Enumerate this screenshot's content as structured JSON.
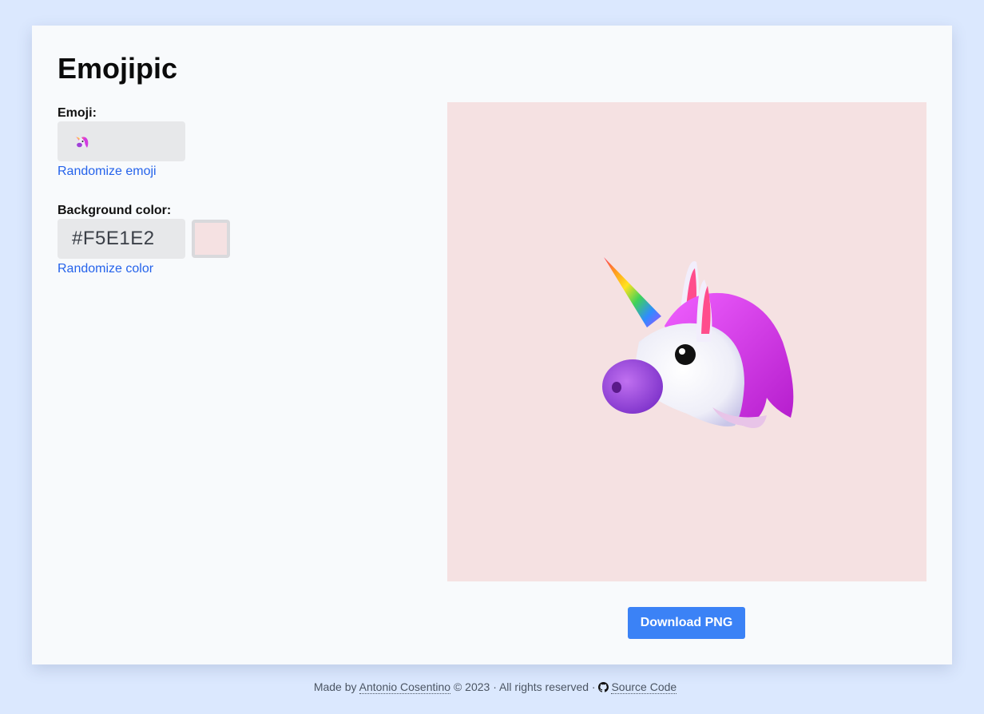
{
  "app": {
    "title": "Emojipic"
  },
  "emoji_field": {
    "label": "Emoji:",
    "value": "🦄",
    "randomize_label": "Randomize emoji"
  },
  "color_field": {
    "label": "Background color:",
    "value": "#F5E1E2",
    "randomize_label": "Randomize color"
  },
  "preview": {
    "background_color": "#F5E1E2",
    "emoji": "unicorn-emoji"
  },
  "actions": {
    "download_label": "Download PNG"
  },
  "footer": {
    "made_by_prefix": "Made by",
    "author": "Antonio Cosentino",
    "copyright": "© 2023 ·  All rights reserved ·",
    "source_label": "Source Code"
  },
  "colors": {
    "page_background": "#dbe8fe",
    "accent": "#3b82f6",
    "link": "#2563eb"
  }
}
